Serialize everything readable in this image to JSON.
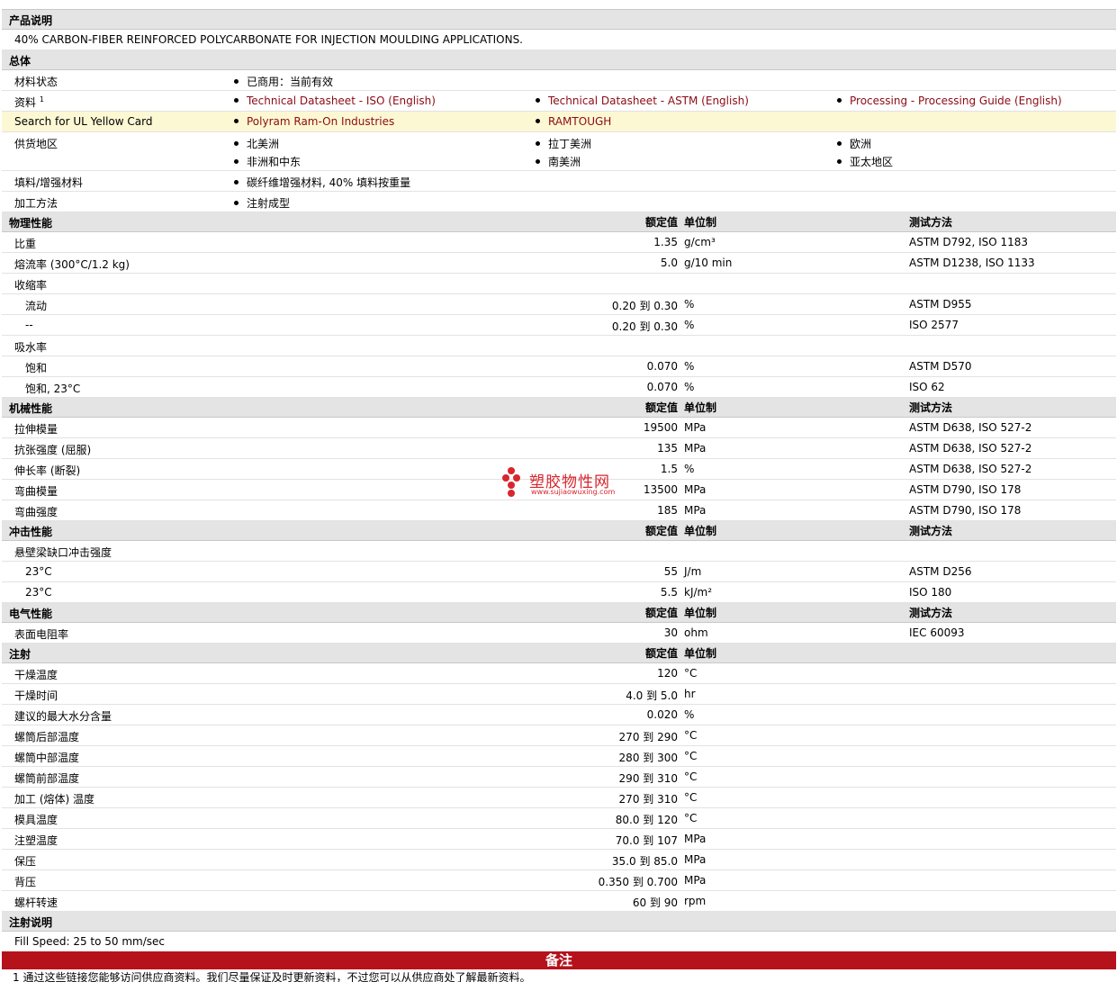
{
  "description": {
    "title": "产品说明",
    "text": "40% CARBON-FIBER REINFORCED POLYCARBONATE FOR INJECTION MOULDING APPLICATIONS."
  },
  "general": {
    "title": "总体",
    "material_status_label": "材料状态",
    "material_status_value": "已商用：当前有效",
    "documents_label": "资料",
    "documents_footnote": "1",
    "documents": [
      "Technical Datasheet - ISO (English)",
      "Technical Datasheet - ASTM (English)",
      "Processing - Processing Guide (English)"
    ],
    "ul_label": "Search for UL Yellow Card",
    "ul_links": [
      "Polyram Ram-On Industries",
      "RAMTOUGH"
    ],
    "regions_label": "供货地区",
    "regions": [
      "北美洲",
      "拉丁美洲",
      "欧洲",
      "非洲和中东",
      "南美洲",
      "亚太地区"
    ],
    "filler_label": "填料/增强材料",
    "filler_value": "碳纤维增强材料, 40% 填料按重量",
    "process_label": "加工方法",
    "process_value": "注射成型"
  },
  "columns": {
    "value": "额定值",
    "unit": "单位制",
    "test": "测试方法"
  },
  "physical": {
    "title": "物理性能",
    "rows": [
      {
        "label": "比重",
        "value": "1.35",
        "unit": "g/cm³",
        "test": "ASTM D792, ISO 1183"
      },
      {
        "label": "熔流率 (300°C/1.2 kg)",
        "value": "5.0",
        "unit": "g/10 min",
        "test": "ASTM D1238, ISO 1133"
      },
      {
        "label": "收缩率",
        "value": "",
        "unit": "",
        "test": ""
      },
      {
        "label": "流动",
        "value": "0.20 到  0.30",
        "unit": "%",
        "test": "ASTM D955"
      },
      {
        "label": "--",
        "value": "0.20 到  0.30",
        "unit": "%",
        "test": "ISO 2577"
      },
      {
        "label": "吸水率",
        "value": "",
        "unit": "",
        "test": ""
      },
      {
        "label": "饱和",
        "value": "0.070",
        "unit": "%",
        "test": "ASTM D570"
      },
      {
        "label": "饱和, 23°C",
        "value": "0.070",
        "unit": "%",
        "test": "ISO 62"
      }
    ]
  },
  "mechanical": {
    "title": "机械性能",
    "rows": [
      {
        "label": "拉伸模量",
        "value": "19500",
        "unit": "MPa",
        "test": "ASTM D638, ISO 527-2"
      },
      {
        "label": "抗张强度 (屈服)",
        "value": "135",
        "unit": "MPa",
        "test": "ASTM D638, ISO 527-2"
      },
      {
        "label": "伸长率 (断裂)",
        "value": "1.5",
        "unit": "%",
        "test": "ASTM D638, ISO 527-2"
      },
      {
        "label": "弯曲模量",
        "value": "13500",
        "unit": "MPa",
        "test": "ASTM D790, ISO 178"
      },
      {
        "label": "弯曲强度",
        "value": "185",
        "unit": "MPa",
        "test": "ASTM D790, ISO 178"
      }
    ]
  },
  "impact": {
    "title": "冲击性能",
    "rows": [
      {
        "label": "悬壁梁缺口冲击强度",
        "value": "",
        "unit": "",
        "test": ""
      },
      {
        "label": "23°C",
        "value": "55",
        "unit": "J/m",
        "test": "ASTM D256"
      },
      {
        "label": "23°C",
        "value": "5.5",
        "unit": "kJ/m²",
        "test": "ISO 180"
      }
    ]
  },
  "electrical": {
    "title": "电气性能",
    "rows": [
      {
        "label": "表面电阻率",
        "value": "30",
        "unit": "ohm",
        "test": "IEC 60093"
      }
    ]
  },
  "injection": {
    "title": "注射",
    "rows": [
      {
        "label": "干燥温度",
        "value": "120",
        "unit": "°C"
      },
      {
        "label": "干燥时间",
        "value": "4.0 到  5.0",
        "unit": "hr"
      },
      {
        "label": "建议的最大水分含量",
        "value": "0.020",
        "unit": "%"
      },
      {
        "label": "螺筒后部温度",
        "value": "270 到  290",
        "unit": "°C"
      },
      {
        "label": "螺筒中部温度",
        "value": "280 到  300",
        "unit": "°C"
      },
      {
        "label": "螺筒前部温度",
        "value": "290 到  310",
        "unit": "°C"
      },
      {
        "label": "加工 (熔体) 温度",
        "value": "270 到  310",
        "unit": "°C"
      },
      {
        "label": "模具温度",
        "value": "80.0 到  120",
        "unit": "°C"
      },
      {
        "label": "注塑温度",
        "value": "70.0 到  107",
        "unit": "MPa"
      },
      {
        "label": "保压",
        "value": "35.0 到  85.0",
        "unit": "MPa"
      },
      {
        "label": "背压",
        "value": "0.350 到  0.700",
        "unit": "MPa"
      },
      {
        "label": "螺杆转速",
        "value": "60 到  90",
        "unit": "rpm"
      }
    ]
  },
  "injection_notes": {
    "title": "注射说明",
    "text": "Fill Speed: 25 to 50 mm/sec"
  },
  "notes_title": "备注",
  "footnote": "1  通过这些链接您能够访问供应商资料。我们尽量保证及时更新资料，不过您可以从供应商处了解最新资料。",
  "watermark": {
    "title": "塑胶物性网",
    "url": "www.sujiaowuxing.com"
  },
  "colors": {
    "link": "#8b0b15",
    "header_bg": "#e4e4e4",
    "highlight_bg": "#fdf8d4",
    "notes_bg": "#b5121b"
  }
}
